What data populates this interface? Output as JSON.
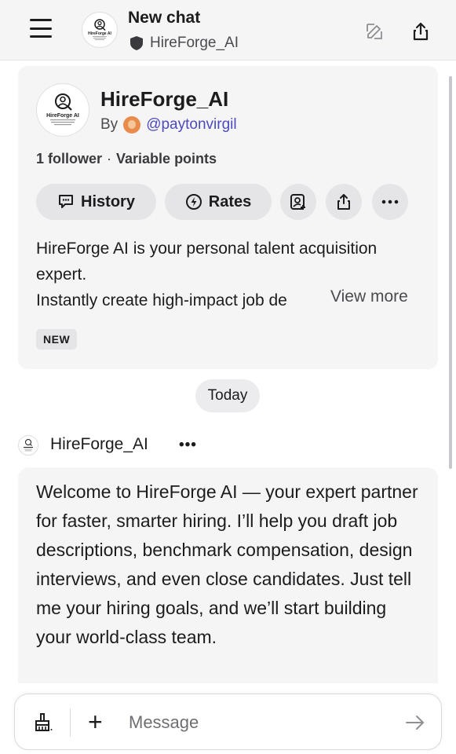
{
  "header": {
    "title": "New chat",
    "subtitle": "HireForge_AI",
    "menu_icon": "menu-icon",
    "edit_icon": "edit-icon",
    "share_icon": "share-icon"
  },
  "bot": {
    "logo_text": "HireForge AI",
    "name": "HireForge_AI",
    "by_label": "By",
    "author_handle": "@paytonvirgil",
    "followers": "1 follower",
    "separator": "·",
    "points": "Variable points",
    "buttons": {
      "history": "History",
      "rates": "Rates"
    },
    "description_line1": "HireForge AI is your personal talent acquisition expert.",
    "description_line2_visible": "Instantly create high-impact job de",
    "view_more": "View more",
    "badge": "NEW"
  },
  "today_label": "Today",
  "message": {
    "sender": "HireForge_AI",
    "more": "•••",
    "text": "Welcome to HireForge AI — your expert partner for faster, smarter hiring. I’ll help you draft job descriptions, benchmark compensation, design interviews, and even close candidates. Just tell me your hiring goals, and we’ll start building your world-class team."
  },
  "composer": {
    "placeholder": "Message",
    "plus": "+",
    "icons": [
      "brush-icon",
      "plus-icon",
      "send-arrow-icon"
    ]
  }
}
